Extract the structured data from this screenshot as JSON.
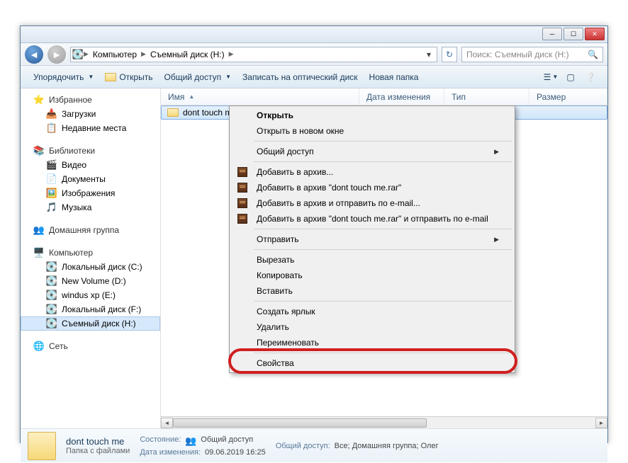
{
  "breadcrumb": {
    "computer": "Компьютер",
    "drive": "Съемный диск (H:)"
  },
  "search": {
    "placeholder": "Поиск: Съемный диск (H:)"
  },
  "toolbar": {
    "organize": "Упорядочить",
    "open": "Открыть",
    "share": "Общий доступ",
    "burn": "Записать на оптический диск",
    "newfolder": "Новая папка"
  },
  "sidebar": {
    "favorites": {
      "title": "Избранное",
      "downloads": "Загрузки",
      "recent": "Недавние места"
    },
    "libraries": {
      "title": "Библиотеки",
      "video": "Видео",
      "documents": "Документы",
      "pictures": "Изображения",
      "music": "Музыка"
    },
    "homegroup": {
      "title": "Домашняя группа"
    },
    "computer": {
      "title": "Компьютер",
      "c": "Локальный диск (C:)",
      "d": "New Volume (D:)",
      "e": "windus xp (E:)",
      "f": "Локальный диск (F:)",
      "h": "Съемный диск (H:)"
    },
    "network": {
      "title": "Сеть"
    }
  },
  "columns": {
    "name": "Имя",
    "date": "Дата изменения",
    "type": "Тип",
    "size": "Размер"
  },
  "file": {
    "name": "dont touch me",
    "date": "09.06.2019 16:25",
    "type": "Папка с файлами"
  },
  "ctx": {
    "open": "Открыть",
    "open_new": "Открыть в новом окне",
    "share": "Общий доступ",
    "add_archive": "Добавить в архив...",
    "add_rar": "Добавить в архив \"dont touch me.rar\"",
    "add_email": "Добавить в архив и отправить по e-mail...",
    "add_rar_email": "Добавить в архив \"dont touch me.rar\" и отправить по e-mail",
    "send": "Отправить",
    "cut": "Вырезать",
    "copy": "Копировать",
    "paste": "Вставить",
    "shortcut": "Создать ярлык",
    "delete": "Удалить",
    "rename": "Переименовать",
    "properties": "Свойства"
  },
  "details": {
    "name": "dont touch me",
    "type": "Папка с файлами",
    "state_label": "Состояние:",
    "state_value": "Общий доступ",
    "modified_label": "Дата изменения:",
    "modified_value": "09.06.2019 16:25",
    "share_label": "Общий доступ:",
    "share_value": "Все; Домашняя группа; Олег"
  }
}
